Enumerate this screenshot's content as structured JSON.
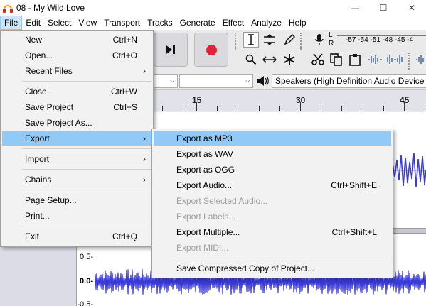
{
  "window": {
    "title": "08 - My Wild Love",
    "controls": {
      "minimize": "—",
      "maximize": "☐",
      "close": "✕"
    }
  },
  "menubar": [
    {
      "label": "File",
      "active": true
    },
    {
      "label": "Edit"
    },
    {
      "label": "Select"
    },
    {
      "label": "View"
    },
    {
      "label": "Transport"
    },
    {
      "label": "Tracks"
    },
    {
      "label": "Generate"
    },
    {
      "label": "Effect"
    },
    {
      "label": "Analyze"
    },
    {
      "label": "Help"
    }
  ],
  "meter": {
    "scale": "-57 -54 -51 -48 -45 -4",
    "left_channel": "L",
    "right_channel": "R"
  },
  "devices": {
    "output": "Speakers (High Definition Audio Device"
  },
  "ruler": {
    "labels": [
      "15",
      "30",
      "45"
    ]
  },
  "tracks": {
    "upper_scale": [],
    "lower_scale": [
      "0.5-",
      "0.0-",
      "-0.5-"
    ]
  },
  "file_menu": {
    "items": [
      {
        "label": "New",
        "shortcut": "Ctrl+N"
      },
      {
        "label": "Open...",
        "shortcut": "Ctrl+O"
      },
      {
        "label": "Recent Files",
        "submenu": true
      },
      {
        "label": "Close",
        "shortcut": "Ctrl+W"
      },
      {
        "label": "Save Project",
        "shortcut": "Ctrl+S"
      },
      {
        "label": "Save Project As..."
      },
      {
        "label": "Export",
        "submenu": true,
        "highlighted": true
      },
      {
        "label": "Import",
        "submenu": true
      },
      {
        "label": "Chains",
        "submenu": true
      },
      {
        "label": "Page Setup..."
      },
      {
        "label": "Print..."
      },
      {
        "label": "Exit",
        "shortcut": "Ctrl+Q"
      }
    ],
    "chevron": "›"
  },
  "export_submenu": {
    "items": [
      {
        "label": "Export as MP3",
        "highlighted": true
      },
      {
        "label": "Export as WAV"
      },
      {
        "label": "Export as OGG"
      },
      {
        "label": "Export Audio...",
        "shortcut": "Ctrl+Shift+E"
      },
      {
        "label": "Export Selected Audio...",
        "disabled": true
      },
      {
        "label": "Export Labels...",
        "disabled": true
      },
      {
        "label": "Export Multiple...",
        "shortcut": "Ctrl+Shift+L"
      },
      {
        "label": "Export MIDI...",
        "disabled": true
      },
      {
        "label": "Save Compressed Copy of Project..."
      }
    ]
  },
  "colors": {
    "menu_highlight": "#91c9f7",
    "waveform": "#3b3bd6",
    "record": "#e0223b"
  }
}
